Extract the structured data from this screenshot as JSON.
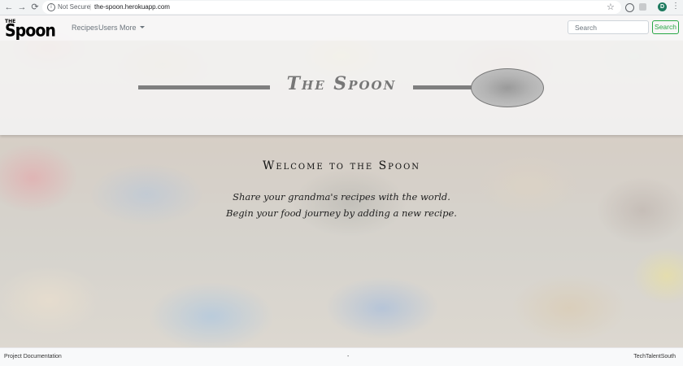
{
  "browser": {
    "back_glyph": "←",
    "forward_glyph": "→",
    "reload_glyph": "⟳",
    "security_label": "Not Secure",
    "separator": "|",
    "url": "the-spoon.herokuapp.com",
    "star_glyph": "☆",
    "profile_initial": "D",
    "menu_glyph": "⋮"
  },
  "navbar": {
    "brand_small": "THE",
    "brand_large": "Spoon",
    "links": [
      "Recipes",
      "Users",
      "More"
    ],
    "search_placeholder": "Search",
    "search_button": "Search",
    "accent_color": "#28a745"
  },
  "hero": {
    "title": "The Spoon"
  },
  "main": {
    "welcome": "Welcome to the Spoon",
    "tagline_1": "Share your grandma's recipes with the world.",
    "tagline_2": "Begin your food journey by adding a new recipe."
  },
  "footer": {
    "left": "Project Documentation",
    "middle": "-",
    "right": "TechTalentSouth"
  }
}
